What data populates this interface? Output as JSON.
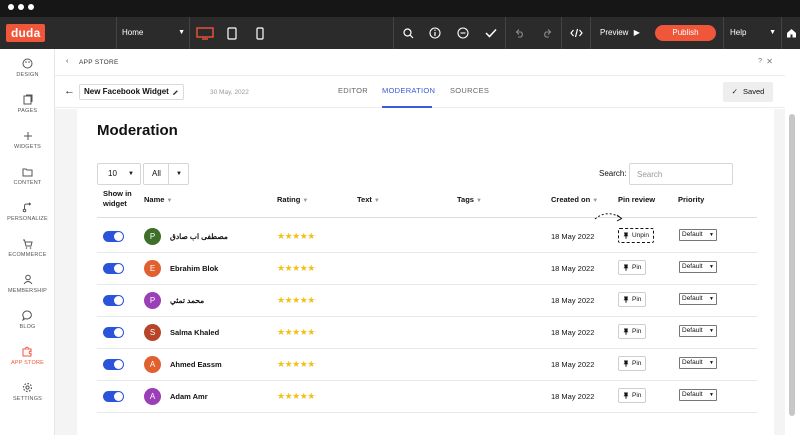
{
  "topbar": {
    "logo": "duda",
    "page_select": "Home",
    "preview_label": "Preview",
    "publish_label": "Publish",
    "help_label": "Help",
    "colors": {
      "accent": "#f0563a",
      "bar": "#2b2b2b"
    }
  },
  "sidebar": {
    "items": [
      {
        "label": "DESIGN",
        "icon": "palette-icon"
      },
      {
        "label": "PAGES",
        "icon": "pages-icon"
      },
      {
        "label": "WIDGETS",
        "icon": "plus-icon"
      },
      {
        "label": "CONTENT",
        "icon": "folder-icon"
      },
      {
        "label": "PERSONALIZE",
        "icon": "personalize-icon"
      },
      {
        "label": "ECOMMERCE",
        "icon": "cart-icon"
      },
      {
        "label": "MEMBERSHIP",
        "icon": "user-icon"
      },
      {
        "label": "BLOG",
        "icon": "chat-icon"
      },
      {
        "label": "APP STORE",
        "icon": "puzzle-icon",
        "active": true
      },
      {
        "label": "SETTINGS",
        "icon": "gear-icon"
      }
    ]
  },
  "breadcrumb": {
    "label": "APP STORE",
    "help": "?",
    "close": "✕"
  },
  "widget_header": {
    "name": "New Facebook Widget",
    "date": "30 May, 2022",
    "tabs": [
      "EDITOR",
      "MODERATION",
      "SOURCES"
    ],
    "active_tab": "MODERATION",
    "saved_label": "Saved"
  },
  "moderation": {
    "title": "Moderation",
    "page_size": "10",
    "filter": "All",
    "search_label": "Search:",
    "search_placeholder": "Search",
    "columns": {
      "show": "Show in widget",
      "name": "Name",
      "rating": "Rating",
      "text": "Text",
      "tags": "Tags",
      "created": "Created on",
      "pin": "Pin review",
      "priority": "Priority"
    },
    "rows": [
      {
        "initial": "P",
        "color": "#3f6e2a",
        "name": "مصطفى اب صادق",
        "stars": "★★★★★",
        "date": "18 May 2022",
        "pin": "Unpin",
        "priority": "Default"
      },
      {
        "initial": "E",
        "color": "#e0612f",
        "name": "Ebrahim Blok",
        "stars": "★★★★★",
        "date": "18 May 2022",
        "pin": "Pin",
        "priority": "Default"
      },
      {
        "initial": "P",
        "color": "#9b3fb9",
        "name": "محمد تمثي",
        "stars": "★★★★★",
        "date": "18 May 2022",
        "pin": "Pin",
        "priority": "Default"
      },
      {
        "initial": "S",
        "color": "#b8452a",
        "name": "Salma Khaled",
        "stars": "★★★★★",
        "date": "18 May 2022",
        "pin": "Pin",
        "priority": "Default"
      },
      {
        "initial": "A",
        "color": "#e0612f",
        "name": "Ahmed Eassm",
        "stars": "★★★★★",
        "date": "18 May 2022",
        "pin": "Pin",
        "priority": "Default"
      },
      {
        "initial": "A",
        "color": "#9b3fb9",
        "name": "Adam Amr",
        "stars": "★★★★★",
        "date": "18 May 2022",
        "pin": "Pin",
        "priority": "Default"
      }
    ]
  }
}
